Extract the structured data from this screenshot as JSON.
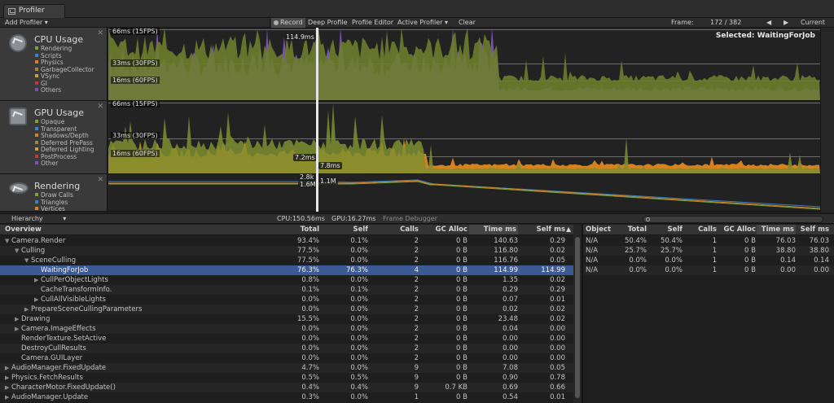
{
  "window": {
    "tab_title": "Profiler"
  },
  "toolbar": {
    "add_profiler": "Add Profiler",
    "record": "Record",
    "deep_profile": "Deep Profile",
    "profile_editor": "Profile Editor",
    "active_profiler": "Active Profiler",
    "clear": "Clear",
    "frame_label": "Frame:",
    "frame_value": "172 / 382",
    "current": "Current"
  },
  "areas": {
    "cpu": {
      "title": "CPU Usage",
      "legend": [
        {
          "label": "Rendering",
          "color": "#7ea33b"
        },
        {
          "label": "Scripts",
          "color": "#3c82c8"
        },
        {
          "label": "Physics",
          "color": "#d6831f"
        },
        {
          "label": "GarbageCollector",
          "color": "#9e8a33"
        },
        {
          "label": "VSync",
          "color": "#c7a532"
        },
        {
          "label": "GI",
          "color": "#c0393b"
        },
        {
          "label": "Others",
          "color": "#7a52b3"
        }
      ],
      "line_labels": [
        "66ms (15FPS)",
        "33ms (30FPS)",
        "16ms (60FPS)"
      ],
      "selected": "Selected: WaitingForJob",
      "marker": "114.9ms"
    },
    "gpu": {
      "title": "GPU Usage",
      "legend": [
        {
          "label": "Opaque",
          "color": "#7ea33b"
        },
        {
          "label": "Transparent",
          "color": "#3c82c8"
        },
        {
          "label": "Shadows/Depth",
          "color": "#d6831f"
        },
        {
          "label": "Deferred PrePass",
          "color": "#9e8a33"
        },
        {
          "label": "Deferred Lighting",
          "color": "#c7a532"
        },
        {
          "label": "PostProcess",
          "color": "#c0393b"
        },
        {
          "label": "Other",
          "color": "#7a52b3"
        }
      ],
      "line_labels": [
        "66ms (15FPS)",
        "33ms (30FPS)",
        "16ms (60FPS)"
      ],
      "marker_left": "7.2ms",
      "marker_right": "7.8ms"
    },
    "rendering": {
      "title": "Rendering",
      "legend": [
        {
          "label": "Draw Calls",
          "color": "#7ea33b"
        },
        {
          "label": "Triangles",
          "color": "#3c82c8"
        },
        {
          "label": "Vertices",
          "color": "#d6831f"
        }
      ],
      "marker_a": "2.8k",
      "marker_b": "1.6M",
      "marker_c": "1.1M"
    }
  },
  "hierarchy_bar": {
    "view": "Hierarchy",
    "cpu": "CPU:150.56ms",
    "gpu": "GPU:16.27ms",
    "frame_debugger": "Frame Debugger"
  },
  "table": {
    "columns": [
      "Overview",
      "Total",
      "Self",
      "Calls",
      "GC Alloc",
      "Time ms",
      "Self ms"
    ],
    "rows": [
      {
        "name": "Camera.Render",
        "total": "93.4%",
        "self": "0.1%",
        "calls": "2",
        "gc": "0 B",
        "time": "140.63",
        "selfms": "0.29"
      },
      {
        "name": "Culling",
        "total": "77.5%",
        "self": "0.0%",
        "calls": "2",
        "gc": "0 B",
        "time": "116.80",
        "selfms": "0.02"
      },
      {
        "name": "SceneCulling",
        "total": "77.5%",
        "self": "0.0%",
        "calls": "2",
        "gc": "0 B",
        "time": "116.76",
        "selfms": "0.05"
      },
      {
        "name": "WaitingForJob",
        "total": "76.3%",
        "self": "76.3%",
        "calls": "4",
        "gc": "0 B",
        "time": "114.99",
        "selfms": "114.99"
      },
      {
        "name": "CullPerObjectLights",
        "total": "0.8%",
        "self": "0.0%",
        "calls": "2",
        "gc": "0 B",
        "time": "1.35",
        "selfms": "0.02"
      },
      {
        "name": "CacheTransformInfo.",
        "total": "0.1%",
        "self": "0.1%",
        "calls": "2",
        "gc": "0 B",
        "time": "0.29",
        "selfms": "0.29"
      },
      {
        "name": "CullAllVisibleLights",
        "total": "0.0%",
        "self": "0.0%",
        "calls": "2",
        "gc": "0 B",
        "time": "0.07",
        "selfms": "0.01"
      },
      {
        "name": "PrepareSceneCullingParameters",
        "total": "0.0%",
        "self": "0.0%",
        "calls": "2",
        "gc": "0 B",
        "time": "0.02",
        "selfms": "0.02"
      },
      {
        "name": "Drawing",
        "total": "15.5%",
        "self": "0.0%",
        "calls": "2",
        "gc": "0 B",
        "time": "23.48",
        "selfms": "0.02"
      },
      {
        "name": "Camera.ImageEffects",
        "total": "0.0%",
        "self": "0.0%",
        "calls": "2",
        "gc": "0 B",
        "time": "0.04",
        "selfms": "0.00"
      },
      {
        "name": "RenderTexture.SetActive",
        "total": "0.0%",
        "self": "0.0%",
        "calls": "2",
        "gc": "0 B",
        "time": "0.00",
        "selfms": "0.00"
      },
      {
        "name": "DestroyCullResults",
        "total": "0.0%",
        "self": "0.0%",
        "calls": "2",
        "gc": "0 B",
        "time": "0.00",
        "selfms": "0.00"
      },
      {
        "name": "Camera.GUILayer",
        "total": "0.0%",
        "self": "0.0%",
        "calls": "2",
        "gc": "0 B",
        "time": "0.00",
        "selfms": "0.00"
      },
      {
        "name": "AudioManager.FixedUpdate",
        "total": "4.7%",
        "self": "0.0%",
        "calls": "9",
        "gc": "0 B",
        "time": "7.08",
        "selfms": "0.05"
      },
      {
        "name": "Physics.FetchResults",
        "total": "0.5%",
        "self": "0.5%",
        "calls": "9",
        "gc": "0 B",
        "time": "0.90",
        "selfms": "0.78"
      },
      {
        "name": "CharacterMotor.FixedUpdate()",
        "total": "0.4%",
        "self": "0.4%",
        "calls": "9",
        "gc": "0.7 KB",
        "time": "0.69",
        "selfms": "0.66"
      },
      {
        "name": "AudioManager.Update",
        "total": "0.3%",
        "self": "0.0%",
        "calls": "1",
        "gc": "0 B",
        "time": "0.54",
        "selfms": "0.01"
      }
    ]
  },
  "object_table": {
    "columns": [
      "Object",
      "Total",
      "Self",
      "Calls",
      "GC Alloc",
      "Time ms",
      "Self ms"
    ],
    "rows": [
      {
        "object": "N/A",
        "total": "50.4%",
        "self": "50.4%",
        "calls": "1",
        "gc": "0 B",
        "time": "76.03",
        "selfms": "76.03"
      },
      {
        "object": "N/A",
        "total": "25.7%",
        "self": "25.7%",
        "calls": "1",
        "gc": "0 B",
        "time": "38.80",
        "selfms": "38.80"
      },
      {
        "object": "N/A",
        "total": "0.0%",
        "self": "0.0%",
        "calls": "1",
        "gc": "0 B",
        "time": "0.14",
        "selfms": "0.14"
      },
      {
        "object": "N/A",
        "total": "0.0%",
        "self": "0.0%",
        "calls": "1",
        "gc": "0 B",
        "time": "0.00",
        "selfms": "0.00"
      }
    ]
  }
}
